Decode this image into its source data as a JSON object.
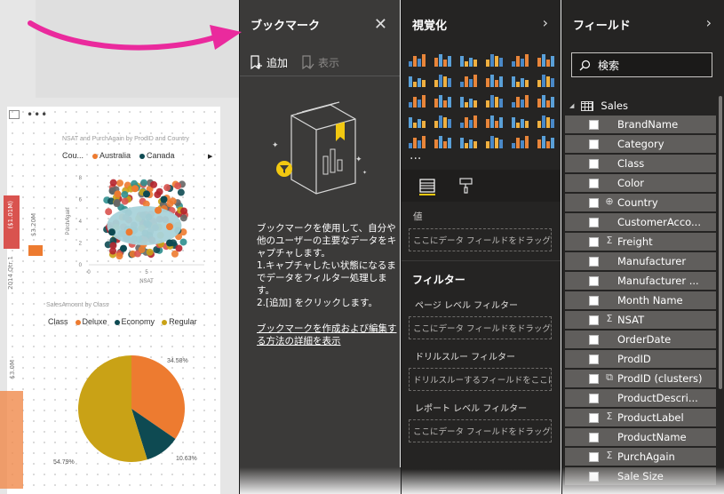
{
  "canvas": {
    "scatter_title": "NSAT and PurchAgain by ProdID and Country",
    "scatter_legend_label": "Cou...",
    "scatter_legend": [
      {
        "name": "Australia",
        "color": "#ed7b30"
      },
      {
        "name": "Canada",
        "color": "#0e4a52"
      }
    ],
    "scatter_xlabel": "NSAT",
    "scatter_ylabel": "PurchAgain",
    "scatter_yticks": [
      "8",
      "6",
      "4",
      "2",
      "0"
    ],
    "scatter_xticks": [
      "0",
      "5"
    ],
    "pie_title": "SalesAmount by Class",
    "pie_legend_label": "Class",
    "pie_legend": [
      {
        "name": "Deluxe",
        "color": "#ed7b30"
      },
      {
        "name": "Economy",
        "color": "#0e4a52"
      },
      {
        "name": "Regular",
        "color": "#c9a216"
      }
    ],
    "left_vtext_1": "($1.01M)",
    "left_vtext_2": "$3.20M",
    "left_vtext_3": "2014 Qtr 1",
    "left_vtext_4": "$3.0M"
  },
  "chart_data": [
    {
      "type": "scatter",
      "title": "NSAT and PurchAgain by ProdID and Country",
      "xlabel": "NSAT",
      "ylabel": "PurchAgain",
      "xlim": [
        0,
        10
      ],
      "ylim": [
        0,
        8
      ],
      "series": [
        {
          "name": "Australia",
          "points": [
            [
              2.5,
              6.5
            ],
            [
              3.5,
              3
            ],
            [
              6,
              5
            ],
            [
              4,
              7
            ],
            [
              7,
              3.5
            ]
          ]
        },
        {
          "name": "Canada",
          "points": [
            [
              2,
              3
            ],
            [
              5,
              6.5
            ],
            [
              7,
              2
            ],
            [
              3,
              1.5
            ],
            [
              6.5,
              6
            ]
          ]
        }
      ]
    },
    {
      "type": "pie",
      "title": "SalesAmount by Class",
      "categories": [
        "Deluxe",
        "Economy",
        "Regular"
      ],
      "values": [
        34.58,
        10.63,
        54.79
      ],
      "labels": [
        "34.58%",
        "10.63%",
        "54.79%"
      ],
      "colors": [
        "#ed7b30",
        "#0e4a52",
        "#c9a216"
      ]
    }
  ],
  "bookmarks": {
    "title": "ブックマーク",
    "add_label": "追加",
    "show_label": "表示",
    "description": "ブックマークを使用して、自分や他のユーザーの主要なデータをキャプチャします。\n1.キャプチャしたい状態になるまでデータをフィルター処理します。\n2.[追加] をクリックします。",
    "learn_more": "ブックマークを作成および編集する方法の詳細を表示"
  },
  "visualizations": {
    "title": "視覚化",
    "more": "...",
    "values_label": "値",
    "values_drop": "ここにデータ フィールドをドラッグ",
    "filters_title": "フィルター",
    "page_filter_label": "ページ レベル フィルター",
    "page_filter_drop": "ここにデータ フィールドをドラッグ",
    "drill_filter_label": "ドリルスルー フィルター",
    "drill_filter_drop": "ドリルスルーするフィールドをここにドラッグ",
    "report_filter_label": "レポート レベル フィルター",
    "report_filter_drop": "ここにデータ フィールドをドラッグ"
  },
  "fields": {
    "title": "フィールド",
    "search_placeholder": "検索",
    "table_name": "Sales",
    "items": [
      {
        "name": "BrandName",
        "icon": ""
      },
      {
        "name": "Category",
        "icon": ""
      },
      {
        "name": "Class",
        "icon": ""
      },
      {
        "name": "Color",
        "icon": ""
      },
      {
        "name": "Country",
        "icon": "globe"
      },
      {
        "name": "CustomerAcco...",
        "icon": ""
      },
      {
        "name": "Freight",
        "icon": "sigma"
      },
      {
        "name": "Manufacturer",
        "icon": ""
      },
      {
        "name": "Manufacturer ...",
        "icon": ""
      },
      {
        "name": "Month Name",
        "icon": ""
      },
      {
        "name": "NSAT",
        "icon": "sigma"
      },
      {
        "name": "OrderDate",
        "icon": ""
      },
      {
        "name": "ProdID",
        "icon": ""
      },
      {
        "name": "ProdID (clusters)",
        "icon": "clusters"
      },
      {
        "name": "ProductDescri...",
        "icon": ""
      },
      {
        "name": "ProductLabel",
        "icon": "sigma"
      },
      {
        "name": "ProductName",
        "icon": ""
      },
      {
        "name": "PurchAgain",
        "icon": "sigma"
      },
      {
        "name": "Sale Size",
        "icon": ""
      }
    ]
  }
}
